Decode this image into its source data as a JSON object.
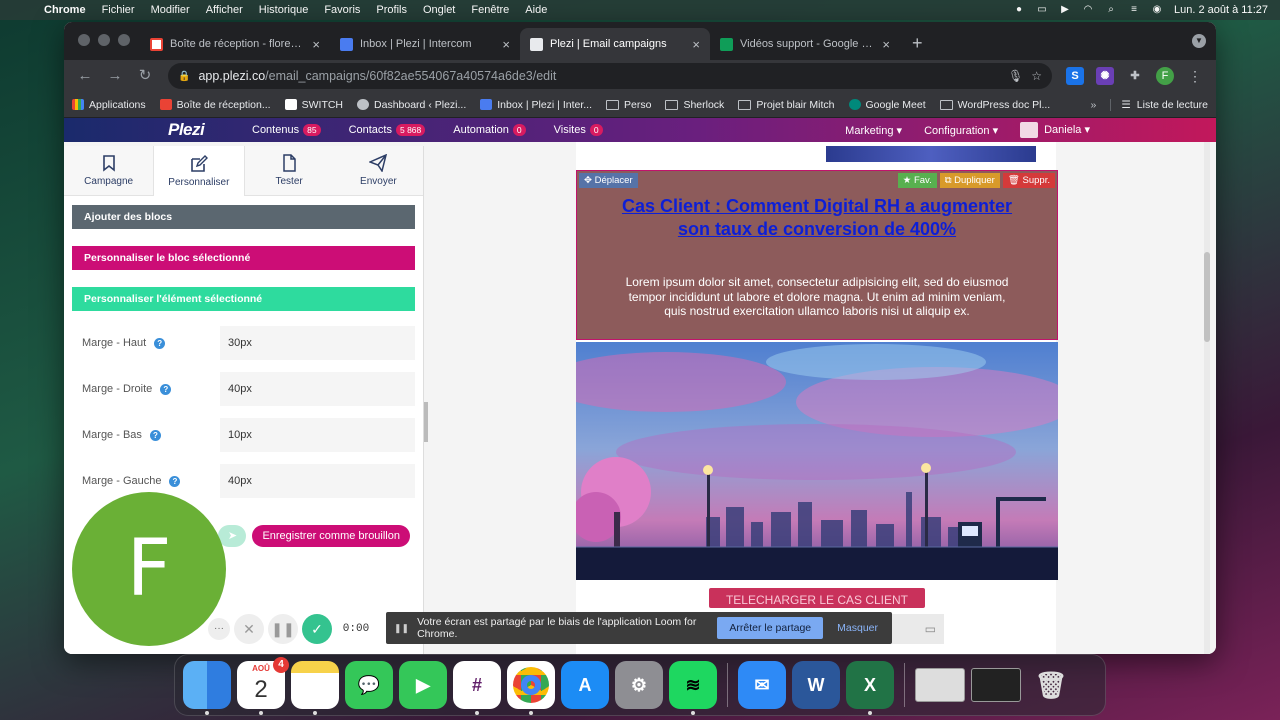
{
  "menubar": {
    "app": "Chrome",
    "items": [
      "Fichier",
      "Modifier",
      "Afficher",
      "Historique",
      "Favoris",
      "Profils",
      "Onglet",
      "Fenêtre",
      "Aide"
    ],
    "datetime": "Lun. 2 août à  11:27"
  },
  "tabs": [
    {
      "label": "Boîte de réception - florent.es...",
      "color": "#ea4335"
    },
    {
      "label": "Inbox | Plezi | Intercom",
      "color": "#4a7cf0"
    },
    {
      "label": "Plezi | Email campaigns",
      "color": "#e8eaed"
    },
    {
      "label": "Vidéos support - Google Sheets",
      "color": "#0f9d58"
    }
  ],
  "address": {
    "domain": "app.plezi.co",
    "path": "/email_campaigns/60f82ae554067a40574a6de3/edit"
  },
  "bookmarks": [
    "Applications",
    "Boîte de réception...",
    "SWITCH",
    "Dashboard ‹ Plezi...",
    "Inbox | Plezi | Inter...",
    "Perso",
    "Sherlock",
    "Projet blair Mitch",
    "Google Meet",
    "WordPress doc Pl..."
  ],
  "bookmarks_more": "»",
  "reading_list": "Liste de lecture",
  "profile_initial": "F",
  "app_header": {
    "logo": "Plezi",
    "nav": [
      {
        "label": "Contenus",
        "badge": "85"
      },
      {
        "label": "Contacts",
        "badge": "5 868"
      },
      {
        "label": "Automation",
        "badge": "0"
      },
      {
        "label": "Visites",
        "badge": "0"
      }
    ],
    "marketing": "Marketing",
    "configuration": "Configuration",
    "user": "Daniela"
  },
  "side_tabs": [
    "Campagne",
    "Personnaliser",
    "Tester",
    "Envoyer"
  ],
  "sections": {
    "add_blocks": "Ajouter des blocs",
    "customize_block": "Personnaliser le bloc sélectionné",
    "customize_element": "Personnaliser l'élément sélectionné"
  },
  "fields": [
    {
      "label": "Marge - Haut",
      "value": "30px"
    },
    {
      "label": "Marge - Droite",
      "value": "40px"
    },
    {
      "label": "Marge - Bas",
      "value": "10px"
    },
    {
      "label": "Marge - Gauche",
      "value": "40px"
    }
  ],
  "save_draft": "Enregistrer comme brouillon",
  "block_tools": {
    "move": "Déplacer",
    "fav": "Fav.",
    "duplicate": "Dupliquer",
    "delete": "Suppr."
  },
  "email": {
    "title": "Cas Client : Comment Digital RH a augmenter son taux de conversion de 400%",
    "body": "Lorem ipsum dolor sit amet, consectetur adipisicing elit, sed do eiusmod tempor incididunt ut labore et dolore magna. Ut enim ad minim veniam, quis nostrud exercitation ullamco laboris nisi ut aliquip ex.",
    "cta": "TELECHARGER LE CAS CLIENT"
  },
  "loom": {
    "initial": "F",
    "timer": "0:00",
    "share_message": "Votre écran est partagé par le biais de l'application Loom for Chrome.",
    "stop_share": "Arrêter le partage",
    "hide": "Masquer"
  },
  "dock": {
    "calendar_month": "AOÛ",
    "calendar_day": "2",
    "calendar_badge": "4"
  }
}
